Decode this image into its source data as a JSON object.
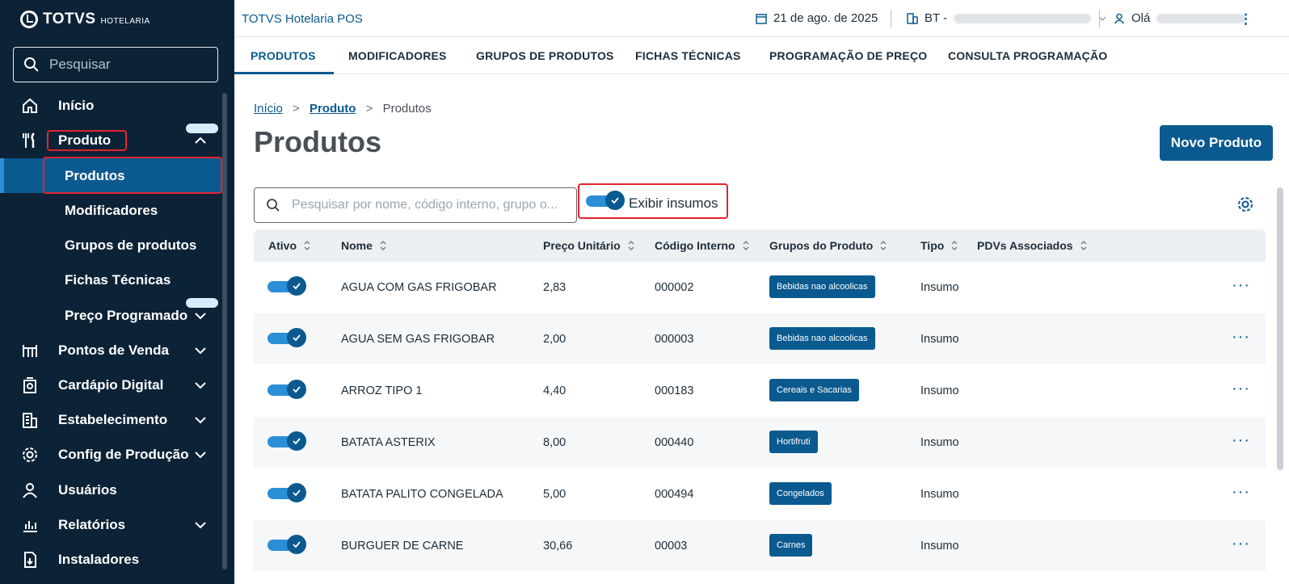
{
  "sidebar": {
    "logo_text": "TOTVS",
    "logo_sub": "HOTELARIA",
    "search_placeholder": "Pesquisar",
    "items": [
      {
        "label": "Início",
        "icon": "home-icon"
      },
      {
        "label": "Produto",
        "icon": "cutlery-icon"
      },
      {
        "label": "Pontos de Venda",
        "icon": "store-icon"
      },
      {
        "label": "Cardápio Digital",
        "icon": "menu-book-icon"
      },
      {
        "label": "Estabelecimento",
        "icon": "building-icon"
      },
      {
        "label": "Config de Produção",
        "icon": "gear-icon"
      },
      {
        "label": "Usuários",
        "icon": "user-icon"
      },
      {
        "label": "Relatórios",
        "icon": "chart-icon"
      },
      {
        "label": "Instaladores",
        "icon": "installer-icon"
      }
    ],
    "sub_items": [
      {
        "label": "Produtos"
      },
      {
        "label": "Modificadores"
      },
      {
        "label": "Grupos de produtos"
      },
      {
        "label": "Fichas Técnicas"
      },
      {
        "label": "Preço Programado"
      }
    ]
  },
  "header": {
    "app_title": "TOTVS Hotelaria POS",
    "date": "21 de ago. de 2025",
    "bt_label": "BT -",
    "greeting": "Olá"
  },
  "tabs": [
    {
      "label": "PRODUTOS"
    },
    {
      "label": "MODIFICADORES"
    },
    {
      "label": "GRUPOS DE PRODUTOS"
    },
    {
      "label": "FICHAS TÉCNICAS"
    },
    {
      "label": "PROGRAMAÇÃO DE PREÇO"
    },
    {
      "label": "CONSULTA PROGRAMAÇÃO"
    }
  ],
  "breadcrumb": {
    "home": "Início",
    "parent": "Produto",
    "current": "Produtos",
    "separator": ">"
  },
  "page": {
    "title": "Produtos",
    "new_button": "Novo Produto",
    "search_placeholder": "Pesquisar por nome, código interno, grupo o...",
    "toggle_label": "Exibir insumos"
  },
  "table": {
    "columns": [
      {
        "label": "Ativo"
      },
      {
        "label": "Nome"
      },
      {
        "label": "Preço Unitário"
      },
      {
        "label": "Código Interno"
      },
      {
        "label": "Grupos do Produto"
      },
      {
        "label": "Tipo"
      },
      {
        "label": "PDVs Associados"
      }
    ],
    "rows": [
      {
        "nome": "AGUA COM GAS FRIGOBAR",
        "preco": "2,83",
        "codigo": "000002",
        "grupo": "Bebidas nao alcoolicas",
        "tipo": "Insumo"
      },
      {
        "nome": "AGUA SEM GAS FRIGOBAR",
        "preco": "2,00",
        "codigo": "000003",
        "grupo": "Bebidas nao alcoolicas",
        "tipo": "Insumo"
      },
      {
        "nome": "ARROZ TIPO 1",
        "preco": "4,40",
        "codigo": "000183",
        "grupo": "Cereais e Sacarias",
        "tipo": "Insumo"
      },
      {
        "nome": "BATATA ASTERIX",
        "preco": "8,00",
        "codigo": "000440",
        "grupo": "Hortifruti",
        "tipo": "Insumo"
      },
      {
        "nome": "BATATA PALITO CONGELADA",
        "preco": "5,00",
        "codigo": "000494",
        "grupo": "Congelados",
        "tipo": "Insumo"
      },
      {
        "nome": "BURGUER DE CARNE",
        "preco": "30,66",
        "codigo": "00003",
        "grupo": "Carnes",
        "tipo": "Insumo"
      }
    ],
    "more_label": "···"
  },
  "colors": {
    "sidebar_bg": "#0c2236",
    "primary": "#0b5a8f",
    "accent": "#2a8fd6",
    "highlight": "#e3232d"
  }
}
